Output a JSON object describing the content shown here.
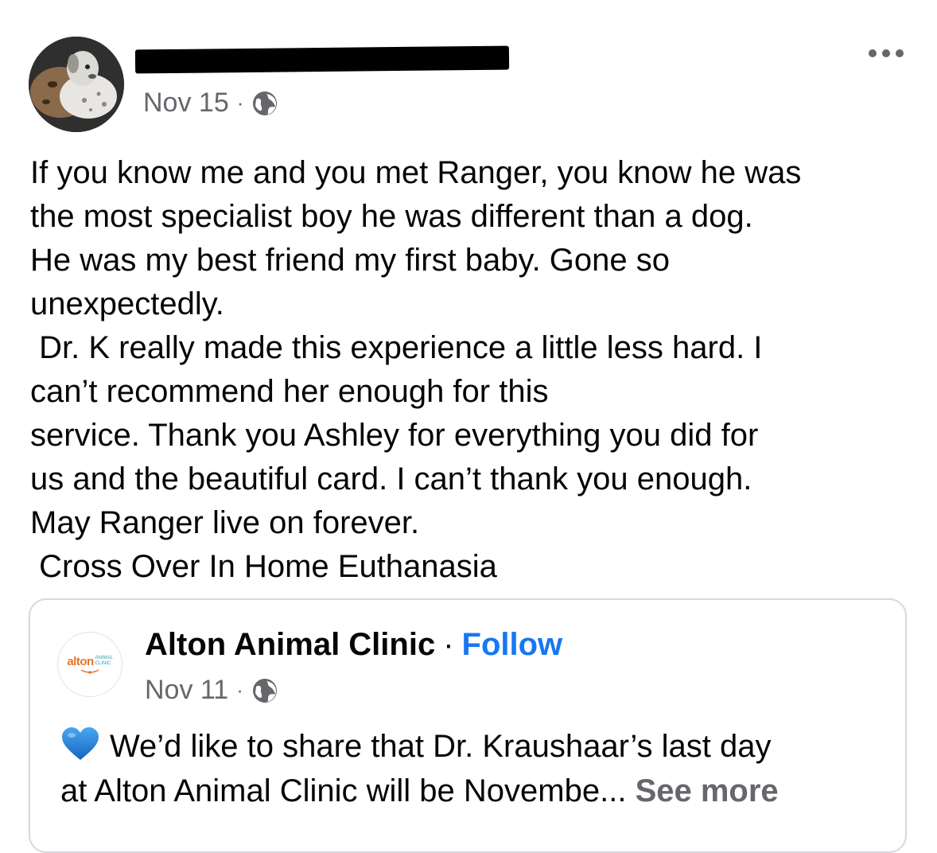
{
  "post": {
    "author_name_redacted": true,
    "date": "Nov 15",
    "privacy_icon": "globe-icon",
    "menu_icon": "more-horizontal-icon",
    "lines": [
      "If you know me and you met Ranger, you know he was",
      "the most specialist boy he was different than a dog.",
      "He was my best friend my first baby. Gone so",
      "unexpectedly.",
      " Dr. K really made this experience a little less hard. I",
      "can’t recommend her enough for this",
      "service. Thank you Ashley for everything you did for",
      "us and the beautiful card. I can’t thank you enough.",
      "May Ranger live on forever.",
      " Cross Over In Home Euthanasia"
    ]
  },
  "shared_post": {
    "logo_text": "alton",
    "logo_subtext": "ANIMAL CLINIC",
    "page_name": "Alton Animal Clinic",
    "separator": "·",
    "follow_label": "Follow",
    "date": "Nov 11",
    "privacy_icon": "globe-icon",
    "emoji_icon": "blue-heart-icon",
    "text_line1": "We’d like to share that Dr. Kraushaar’s last day",
    "text_line2": "at Alton Animal Clinic will be Novembe...",
    "see_more_label": "See more"
  },
  "colors": {
    "link_blue": "#1877f2",
    "secondary_text": "#65676b",
    "heart_blue": "#1e88e5"
  }
}
